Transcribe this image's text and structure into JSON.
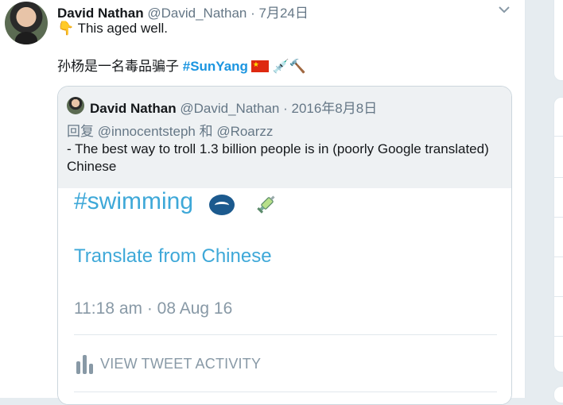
{
  "tweet": {
    "author_name": "David Nathan",
    "author_handle": "@David_Nathan",
    "date": "· 7月24日",
    "line1_emoji": "👇",
    "line1_text": "This aged well.",
    "line2_text": "孙杨是一名毒品骗子 ",
    "line2_hashtag": "#SunYang",
    "line2_emojis_after_flag": " 💉🔨"
  },
  "quote": {
    "author_name": "David Nathan",
    "author_handle": "@David_Nathan",
    "date": "· 2016年8月8日",
    "reply_prefix": "回复 ",
    "reply_user1": "@innocentsteph",
    "reply_and": " 和 ",
    "reply_user2": "@Roarzz",
    "text": "- The best way to troll 1.3 billion people is in (poorly Google translated) Chinese"
  },
  "embedded_screenshot": {
    "hashtag": "#swimming",
    "translate_link": "Translate from Chinese",
    "timestamp": "11:18 am · 08 Aug 16",
    "activity_label": "VIEW TWEET ACTIVITY"
  },
  "icons": {
    "chevron": "chevron-down-icon",
    "flag": "china-flag-icon",
    "swimming": "swimming-icon",
    "syringe": "syringe-icon",
    "activity": "bar-chart-icon"
  },
  "colors": {
    "hashtag": "#1b95e0",
    "link_light": "#3ea8d8",
    "muted": "#657786",
    "quote_bg": "#eef1f3"
  }
}
